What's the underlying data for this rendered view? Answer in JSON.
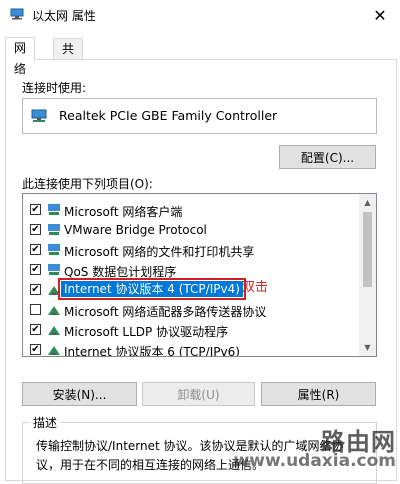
{
  "window": {
    "title": "以太网 属性",
    "close_glyph": "✕"
  },
  "tabs": [
    {
      "label": "网络",
      "active": true
    },
    {
      "label": "共享",
      "active": false
    }
  ],
  "connect_using": {
    "label": "连接时使用:",
    "adapter_name": "Realtek PCIe GBE Family Controller",
    "configure_button": "配置(C)..."
  },
  "items_section": {
    "label": "此连接使用下列项目(O):",
    "items": [
      {
        "label": "Microsoft 网络客户端",
        "checked": true,
        "icon": "network-client-icon"
      },
      {
        "label": "VMware Bridge Protocol",
        "checked": true,
        "icon": "network-service-icon"
      },
      {
        "label": "Microsoft 网络的文件和打印机共享",
        "checked": true,
        "icon": "network-service-icon"
      },
      {
        "label": "QoS 数据包计划程序",
        "checked": true,
        "icon": "network-service-icon"
      },
      {
        "label": "Internet 协议版本 4 (TCP/IPv4)",
        "checked": true,
        "icon": "protocol-icon",
        "selected": true
      },
      {
        "label": "Microsoft 网络适配器多路传送器协议",
        "checked": false,
        "icon": "protocol-icon"
      },
      {
        "label": "Microsoft LLDP 协议驱动程序",
        "checked": true,
        "icon": "protocol-icon"
      },
      {
        "label": "Internet 协议版本 6 (TCP/IPv6)",
        "checked": true,
        "icon": "protocol-icon"
      }
    ],
    "annotation": "双击"
  },
  "buttons": {
    "install": "安装(N)...",
    "uninstall": "卸载(U)",
    "properties": "属性(R)"
  },
  "description": {
    "title": "描述",
    "text": "传输控制协议/Internet 协议。该协议是默认的广域网络协议，用于在不同的相互连接的网络上通信。"
  },
  "watermark": {
    "brand": "路由网",
    "site": "www.udaxia.com"
  },
  "colors": {
    "selection": "#0078d7",
    "highlight_box": "#d02020",
    "annotation": "#e02020"
  }
}
